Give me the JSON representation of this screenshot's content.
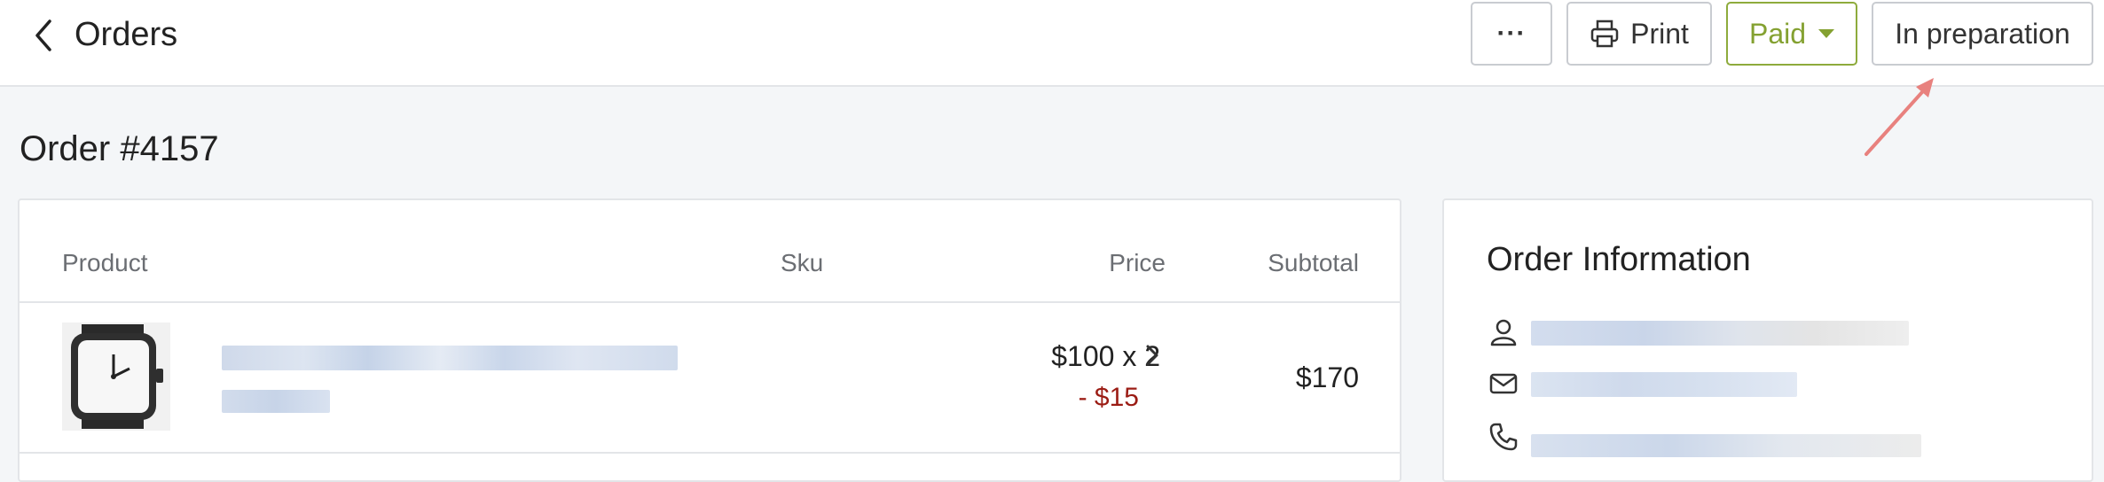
{
  "header": {
    "title": "Orders",
    "actions": {
      "more_label": "···",
      "print_label": "Print",
      "paid_label": "Paid",
      "status_label": "In preparation"
    }
  },
  "order": {
    "title": "Order #4157"
  },
  "products_table": {
    "columns": {
      "product": "Product",
      "sku": "Sku",
      "price": "Price",
      "subtotal": "Subtotal"
    },
    "rows": [
      {
        "price": "$100 x 2",
        "discount": "- $15",
        "subtotal": "$170"
      }
    ]
  },
  "info_panel": {
    "title": "Order Information"
  },
  "colors": {
    "accent_green": "#84a131",
    "discount_red": "#9b1c14",
    "annotation_arrow": "#e8817e"
  }
}
